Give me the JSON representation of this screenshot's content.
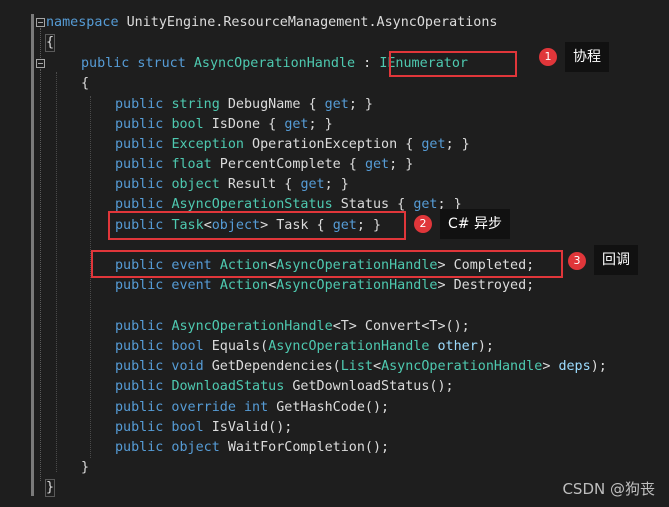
{
  "code": {
    "namespace_kw": "namespace",
    "namespace_name": "UnityEngine.ResourceManagement.AsyncOperations",
    "open_brace": "{",
    "close_brace": "}",
    "struct_line": {
      "mods": "public struct",
      "name": "AsyncOperationHandle",
      "colon": " : ",
      "base": "IEnumerator"
    },
    "members": [
      {
        "kw": "public",
        "type": "string",
        "rest": " DebugName { ",
        "get": "get",
        "tail": "; }"
      },
      {
        "kw": "public",
        "type": "bool",
        "rest": " IsDone { ",
        "get": "get",
        "tail": "; }"
      },
      {
        "kw": "public",
        "type": "Exception",
        "rest": " OperationException { ",
        "get": "get",
        "tail": "; }"
      },
      {
        "kw": "public",
        "type": "float",
        "rest": " PercentComplete { ",
        "get": "get",
        "tail": "; }"
      },
      {
        "kw": "public",
        "type": "object",
        "rest": " Result { ",
        "get": "get",
        "tail": "; }"
      },
      {
        "kw": "public",
        "type": "AsyncOperationStatus",
        "rest": " Status { ",
        "get": "get",
        "tail": "; }"
      }
    ],
    "task_line": {
      "kw": "public",
      "type": "Task",
      "lt": "<",
      "arg": "object",
      "gt": ">",
      "rest": " Task { ",
      "get": "get",
      "tail": "; }"
    },
    "event_lines": [
      {
        "kw": "public event",
        "type": "Action",
        "lt": "<",
        "arg": "AsyncOperationHandle",
        "gt": ">",
        "name": " Completed;"
      },
      {
        "kw": "public event",
        "type": "Action",
        "lt": "<",
        "arg": "AsyncOperationHandle",
        "gt": ">",
        "name": " Destroyed;"
      }
    ],
    "methods": [
      {
        "parts": [
          [
            "kw",
            "public "
          ],
          [
            "ty",
            "AsyncOperationHandle"
          ],
          [
            "pl",
            "<T> Convert<T>();"
          ]
        ]
      },
      {
        "parts": [
          [
            "kw",
            "public bool "
          ],
          [
            "pl",
            "Equals("
          ],
          [
            "ty",
            "AsyncOperationHandle"
          ],
          [
            "pm",
            " other"
          ],
          [
            "pl",
            ");"
          ]
        ]
      },
      {
        "parts": [
          [
            "kw",
            "public void "
          ],
          [
            "pl",
            "GetDependencies("
          ],
          [
            "ty",
            "List"
          ],
          [
            "pl",
            "<"
          ],
          [
            "ty",
            "AsyncOperationHandle"
          ],
          [
            "pl",
            "> "
          ],
          [
            "pm",
            "deps"
          ],
          [
            "pl",
            ");"
          ]
        ]
      },
      {
        "parts": [
          [
            "kw",
            "public "
          ],
          [
            "ty",
            "DownloadStatus"
          ],
          [
            "pl",
            " GetDownloadStatus();"
          ]
        ]
      },
      {
        "parts": [
          [
            "kw",
            "public override int "
          ],
          [
            "pl",
            "GetHashCode();"
          ]
        ]
      },
      {
        "parts": [
          [
            "kw",
            "public bool "
          ],
          [
            "pl",
            "IsValid();"
          ]
        ]
      },
      {
        "parts": [
          [
            "kw",
            "public object "
          ],
          [
            "pl",
            "WaitForCompletion();"
          ]
        ]
      }
    ]
  },
  "annotations": [
    {
      "number": "1",
      "label": "协程"
    },
    {
      "number": "2",
      "label": "C# 异步"
    },
    {
      "number": "3",
      "label": "回调"
    }
  ],
  "colors": {
    "accent": "#e0363a",
    "keyword": "#569cd6",
    "type": "#4ec9b0",
    "param": "#9cdcfe",
    "background": "#1e1e1e"
  },
  "watermark": "CSDN @狗丧"
}
